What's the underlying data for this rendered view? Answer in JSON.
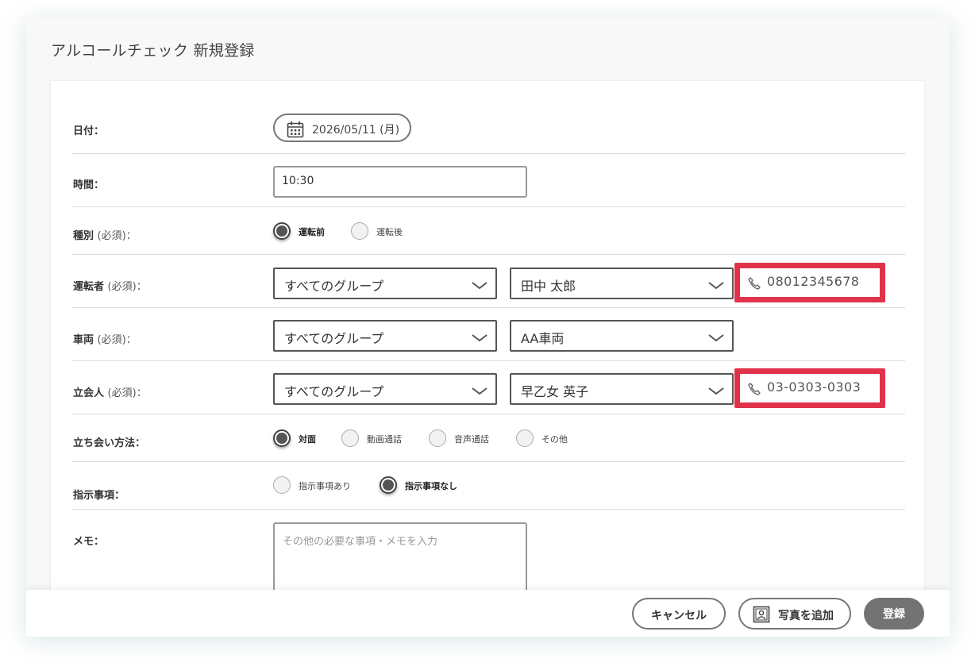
{
  "dialog": {
    "title": "アルコールチェック 新規登録"
  },
  "form": {
    "date": {
      "label": "日付：",
      "value": "2026/05/11 (月)"
    },
    "time": {
      "label": "時間：",
      "value": "10:30"
    },
    "type": {
      "label": "種別",
      "required": "(必須)：",
      "options": [
        {
          "label": "運転前",
          "selected": true
        },
        {
          "label": "運転後",
          "selected": false
        }
      ]
    },
    "driver": {
      "label": "運転者",
      "required": "(必須)：",
      "group": "すべてのグループ",
      "person": "田中 太郎",
      "phone": "08012345678"
    },
    "vehicle": {
      "label": "車両",
      "required": "(必須)：",
      "group": "すべてのグループ",
      "vehicle": "AA車両"
    },
    "witness": {
      "label": "立会人",
      "required": "(必須)：",
      "group": "すべてのグループ",
      "person": "早乙女 英子",
      "phone": "03-0303-0303"
    },
    "method": {
      "label": "立ち会い方法：",
      "options": [
        {
          "label": "対面",
          "selected": true
        },
        {
          "label": "動画通話",
          "selected": false
        },
        {
          "label": "音声通話",
          "selected": false
        },
        {
          "label": "その他",
          "selected": false
        }
      ]
    },
    "instructions": {
      "label": "指示事項：",
      "options": [
        {
          "label": "指示事項あり",
          "selected": false
        },
        {
          "label": "指示事項なし",
          "selected": true
        }
      ]
    },
    "memo": {
      "label": "メモ：",
      "placeholder": "その他の必要な事項・メモを入力"
    }
  },
  "footer": {
    "cancel": "キャンセル",
    "add_photo": "写真を追加",
    "submit": "登録"
  },
  "colors": {
    "highlight": "#e0334b",
    "submit_button": "#737373"
  },
  "icons": {
    "date": "calendar-icon",
    "phone": "phone-icon",
    "photo": "photo-icon",
    "dropdown": "chevron-down-icon"
  }
}
